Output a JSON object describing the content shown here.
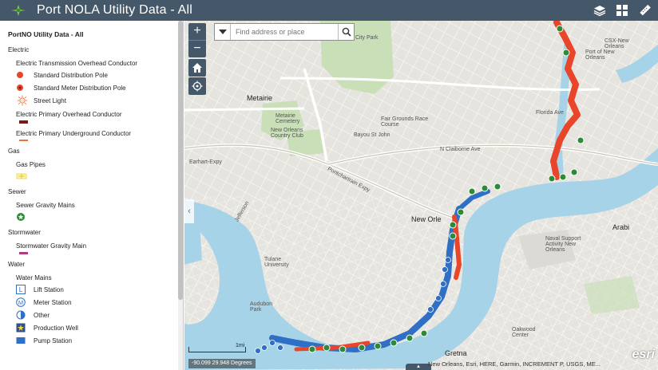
{
  "header": {
    "title": "Port NOLA Utility Data - All",
    "tools": [
      {
        "icon": "layers-icon"
      },
      {
        "icon": "grid-icon"
      },
      {
        "icon": "measure-icon"
      }
    ]
  },
  "legend": {
    "title": "PortNO Utility Data - All",
    "groups": [
      {
        "name": "Electric",
        "layers": [
          {
            "name": "Electric Transmission Overhead Conductor",
            "items": [
              {
                "label": "Standard Distribution Pole",
                "symbol": "dot-red"
              },
              {
                "label": "Standard Meter Distribution Pole",
                "symbol": "dot-red-ring"
              },
              {
                "label": "Street Light",
                "symbol": "sun-orange"
              }
            ]
          },
          {
            "name": "Electric Primary Overhead Conductor",
            "line": "#7a1a1a"
          },
          {
            "name": "Electric Primary Underground Conductor",
            "line": "#e8723a"
          }
        ]
      },
      {
        "name": "Gas",
        "layers": [
          {
            "name": "Gas Pipes",
            "symbol": "gas-yellow"
          }
        ]
      },
      {
        "name": "Sewer",
        "layers": [
          {
            "name": "Sewer Gravity Mains",
            "symbol": "sewer-green"
          }
        ]
      },
      {
        "name": "Stormwater",
        "layers": [
          {
            "name": "Stormwater Gravity Main",
            "line": "#b03a7a"
          }
        ]
      },
      {
        "name": "Water",
        "layers": [
          {
            "name": "Water Mains",
            "items": [
              {
                "label": "Lift Station",
                "symbol": "L"
              },
              {
                "label": "Meter Station",
                "symbol": "M"
              },
              {
                "label": "Other",
                "symbol": "other"
              },
              {
                "label": "Production Well",
                "symbol": "well"
              },
              {
                "label": "Pump Station",
                "symbol": "pump"
              }
            ]
          }
        ]
      }
    ]
  },
  "map": {
    "search_placeholder": "Find address or place",
    "zoom_in": "+",
    "zoom_out": "−",
    "scale_label": "1mi",
    "coordinates": "-90.099 29.948 Degrees",
    "attribution": "New Orleans, Esri, HERE, Garmin, INCREMENT P, USGS, ME...",
    "esri_logo": "esri",
    "places": [
      {
        "text": "Metairie",
        "kind": "city"
      },
      {
        "text": "New Orle",
        "kind": "city"
      },
      {
        "text": "Gretna",
        "kind": "city"
      },
      {
        "text": "Arabi",
        "kind": "city"
      },
      {
        "text": "Metairie Cemetery",
        "kind": "small"
      },
      {
        "text": "New Orleans Country Club",
        "kind": "small"
      },
      {
        "text": "Fair Grounds Race Course",
        "kind": "small"
      },
      {
        "text": "Bayou St John",
        "kind": "small"
      },
      {
        "text": "City Park",
        "kind": "small"
      },
      {
        "text": "Tulane University",
        "kind": "small"
      },
      {
        "text": "Audubon Park",
        "kind": "small"
      },
      {
        "text": "Naval Support Activity New Orleans",
        "kind": "small"
      },
      {
        "text": "Earhart-Expy",
        "kind": "small"
      },
      {
        "text": "N Claiborne Ave",
        "kind": "small"
      },
      {
        "text": "Pontchartrain Expy",
        "kind": "small"
      },
      {
        "text": "Florida Ave",
        "kind": "small"
      },
      {
        "text": "Jefferson",
        "kind": "small"
      },
      {
        "text": "Oakwood Center",
        "kind": "small"
      },
      {
        "text": "Port of New Orleans",
        "kind": "small"
      },
      {
        "text": "CSX-New Orleans",
        "kind": "small"
      }
    ],
    "colors": {
      "river": "#a7d3e8",
      "land": "#e6e4de",
      "park": "#c9dfb8",
      "electric": "#e8452a",
      "sewer": "#2d8a36",
      "water": "#2f6fc5"
    }
  }
}
